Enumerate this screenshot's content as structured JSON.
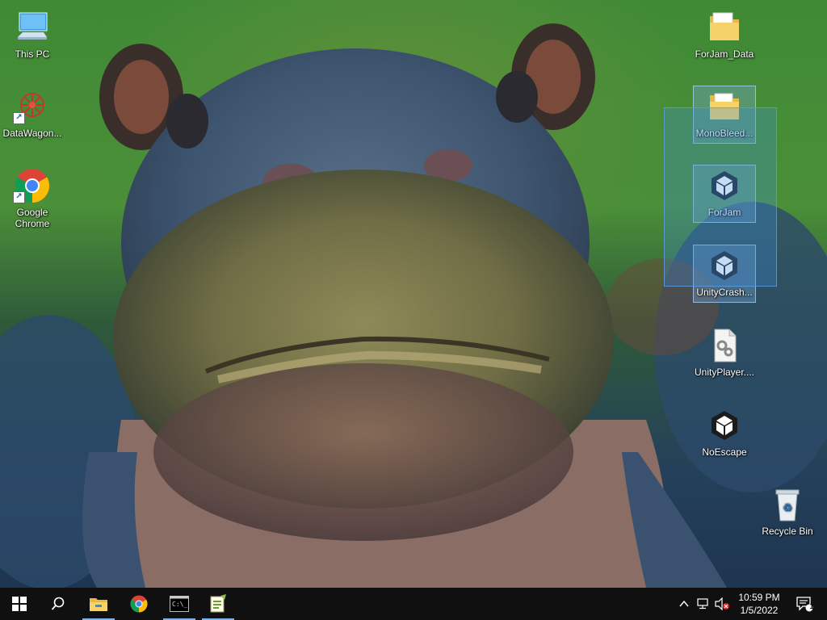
{
  "desktop": {
    "left_icons": [
      {
        "label": "This PC",
        "icon": "this-pc-icon"
      },
      {
        "label": "DataWagon...",
        "icon": "datawagon-icon",
        "shortcut": true
      },
      {
        "label": "Google Chrome",
        "icon": "chrome-icon",
        "shortcut": true
      }
    ],
    "right_icons": [
      {
        "label": "ForJam_Data",
        "icon": "folder-icon"
      },
      {
        "label": "MonoBleed...",
        "icon": "folder-icon",
        "selected": true
      },
      {
        "label": "ForJam",
        "icon": "unity-icon",
        "selected": true
      },
      {
        "label": "UnityCrash...",
        "icon": "unity-icon",
        "selected": true
      },
      {
        "label": "UnityPlayer....",
        "icon": "dll-file-icon"
      },
      {
        "label": "NoEscape",
        "icon": "unity-icon"
      },
      {
        "label": "Recycle Bin",
        "icon": "recycle-bin-icon"
      }
    ]
  },
  "taskbar": {
    "pinned": [
      {
        "name": "start-button",
        "icon": "windows-logo-icon"
      },
      {
        "name": "search-button",
        "icon": "search-icon"
      },
      {
        "name": "file-explorer-button",
        "icon": "file-explorer-icon",
        "running": true
      },
      {
        "name": "chrome-button",
        "icon": "chrome-icon"
      },
      {
        "name": "cmd-button",
        "icon": "command-prompt-icon",
        "running": true
      },
      {
        "name": "notepad-button",
        "icon": "notepad-plus-icon",
        "running": true
      }
    ],
    "tray": {
      "time": "10:59 PM",
      "date": "1/5/2022",
      "notification_count": "1"
    }
  },
  "colors": {
    "taskbar": "#101010",
    "running_indicator": "#7db3e8",
    "selection_fill": "#3c8cdc"
  }
}
